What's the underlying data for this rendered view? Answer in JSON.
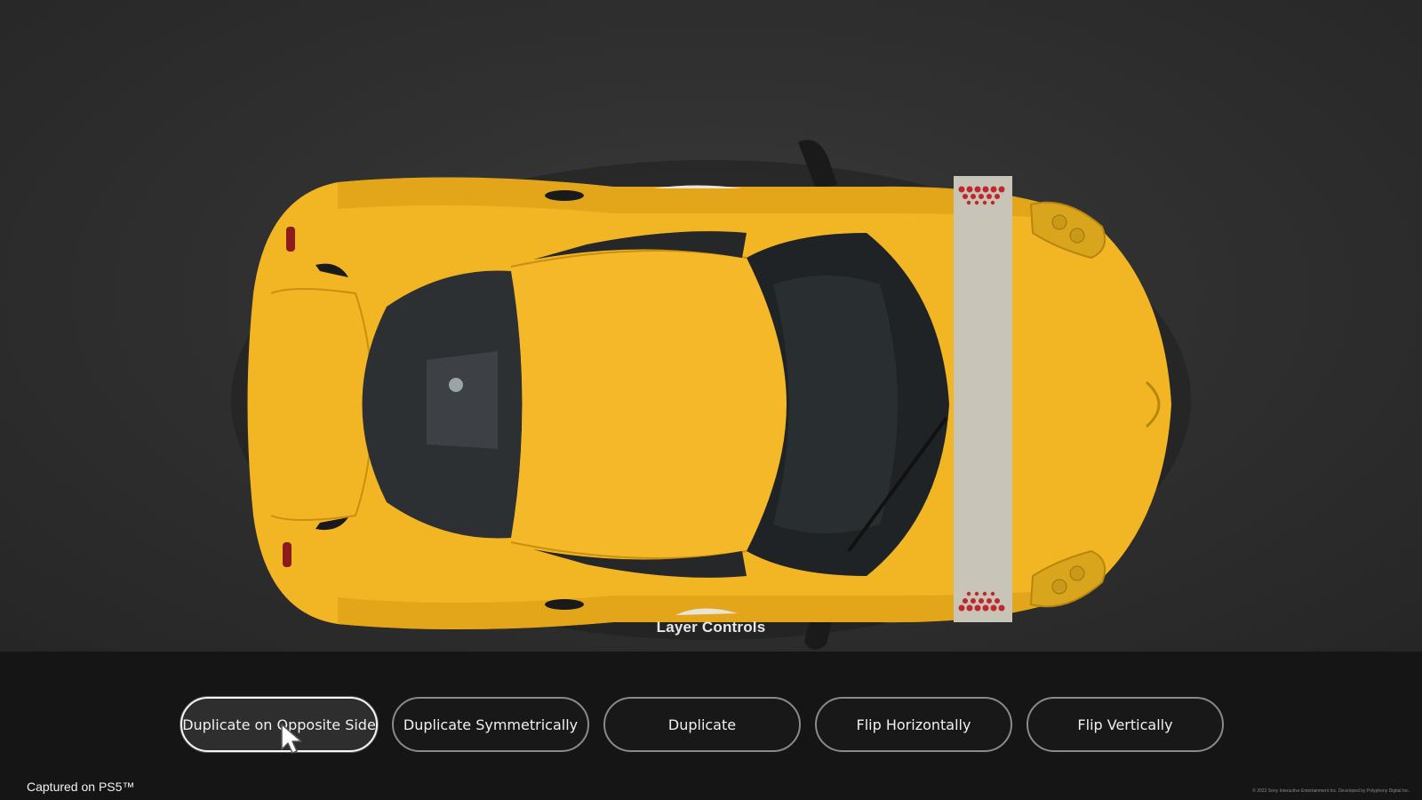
{
  "viewport": {
    "title": "Layer Controls"
  },
  "layer_controls": {
    "buttons": [
      {
        "label": "Duplicate on Opposite Side",
        "state": "focused"
      },
      {
        "label": "Duplicate Symmetrically",
        "state": "normal"
      },
      {
        "label": "Duplicate",
        "state": "normal"
      },
      {
        "label": "Flip Horizontally",
        "state": "normal"
      },
      {
        "label": "Flip Vertically",
        "state": "normal"
      }
    ]
  },
  "footer": {
    "captured": "Captured on PS5™",
    "copyright": "© 2022 Sony Interactive Entertainment Inc. Developed by Polyphony Digital Inc."
  },
  "colors": {
    "car_body": "#f2b524",
    "stripe": "#c8c4b8",
    "dots": "#c0262c",
    "background": "#2e2e2e",
    "panel": "#151515"
  },
  "icons": {
    "cursor": "arrow-pointer-icon"
  }
}
